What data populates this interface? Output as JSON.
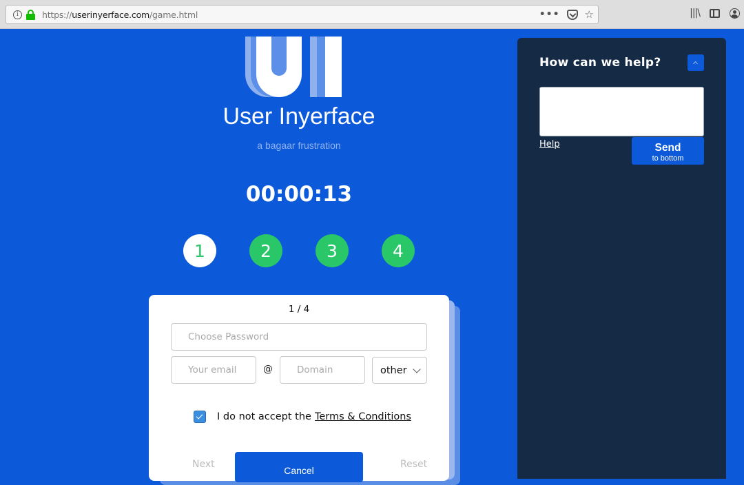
{
  "browser": {
    "url_prefix": "https://",
    "url_domain": "userinyerface.com",
    "url_path": "/game.html",
    "page_actions_label": "•••"
  },
  "brand": {
    "logo_text": "UI",
    "title": "User Inyerface",
    "tagline": "a bagaar frustration"
  },
  "timer": "00:00:13",
  "steps": [
    {
      "label": "1",
      "active": true
    },
    {
      "label": "2",
      "active": false
    },
    {
      "label": "3",
      "active": false
    },
    {
      "label": "4",
      "active": false
    }
  ],
  "form": {
    "counter": "1 / 4",
    "password_placeholder": "Choose Password",
    "password_value": "",
    "email_placeholder": "Your email",
    "email_value": "",
    "at_symbol": "@",
    "domain_placeholder": "Domain",
    "domain_value": "",
    "tld_selected": "other",
    "terms_checked": true,
    "terms_prefix": "I do not accept the",
    "terms_link": "Terms & Conditions",
    "next_label": "Next",
    "cancel_label": "Cancel",
    "reset_label": "Reset"
  },
  "help": {
    "title": "How can we help?",
    "textarea_value": "",
    "help_link": "Help",
    "send_label": "Send",
    "send_sublabel": "to bottom"
  },
  "colors": {
    "background": "#0c59d9",
    "step_green": "#2ac769",
    "help_panel": "#152a45"
  }
}
